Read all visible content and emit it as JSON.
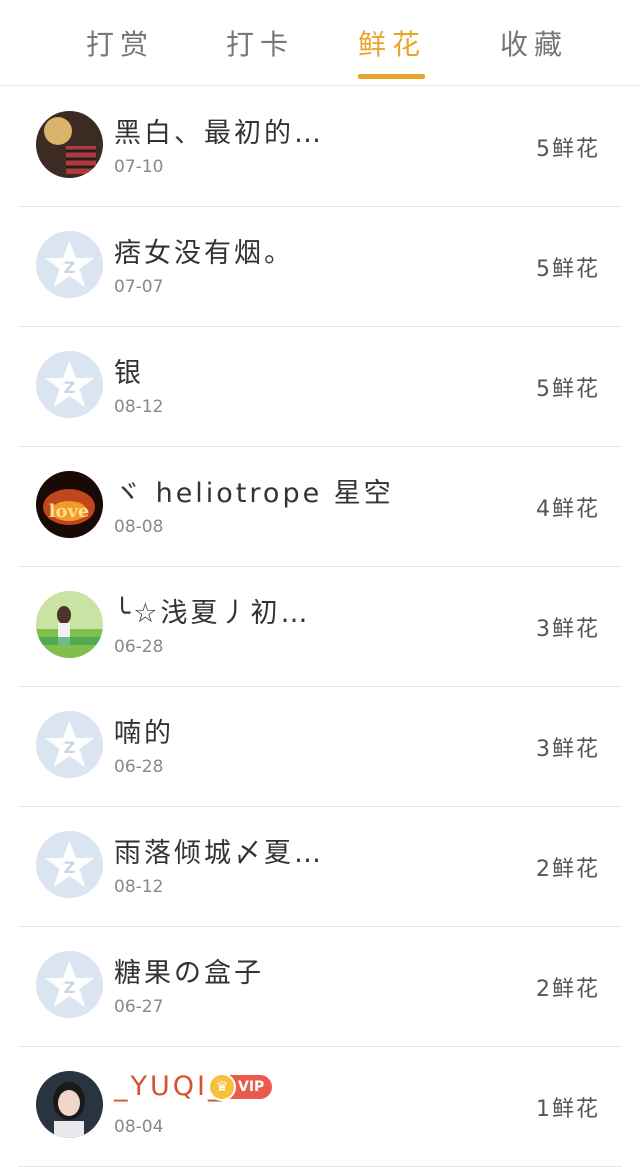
{
  "tabs": [
    {
      "label": "打赏"
    },
    {
      "label": "打卡"
    },
    {
      "label": "鲜花"
    },
    {
      "label": "收藏"
    }
  ],
  "active_tab": 2,
  "rows": [
    {
      "name": "黑白、最初的…",
      "date": "07-10",
      "count": "5鲜花",
      "avatar": "photo-avatar-dark"
    },
    {
      "name": "痞女没有烟。",
      "date": "07-07",
      "count": "5鲜花",
      "avatar": "default-qzone-avatar"
    },
    {
      "name": "银",
      "date": "08-12",
      "count": "5鲜花",
      "avatar": "default-qzone-avatar"
    },
    {
      "name": "ヾ heliotrope 星空",
      "date": "08-08",
      "count": "4鲜花",
      "avatar": "love-fire-avatar"
    },
    {
      "name": "╰☆浅夏丿初…",
      "date": "06-28",
      "count": "3鲜花",
      "avatar": "girl-photo-avatar"
    },
    {
      "name": "喃的",
      "date": "06-28",
      "count": "3鲜花",
      "avatar": "default-qzone-avatar"
    },
    {
      "name": "雨落倾城〆夏…",
      "date": "08-12",
      "count": "2鲜花",
      "avatar": "default-qzone-avatar"
    },
    {
      "name": "糖果の盒子",
      "date": "06-27",
      "count": "2鲜花",
      "avatar": "default-qzone-avatar"
    },
    {
      "name": "_YUQI_",
      "date": "08-04",
      "count": "1鲜花",
      "avatar": "portrait-avatar",
      "vip": "VIP"
    }
  ],
  "colors": {
    "accent": "#e8a52a",
    "vip": "#e95b4c"
  }
}
